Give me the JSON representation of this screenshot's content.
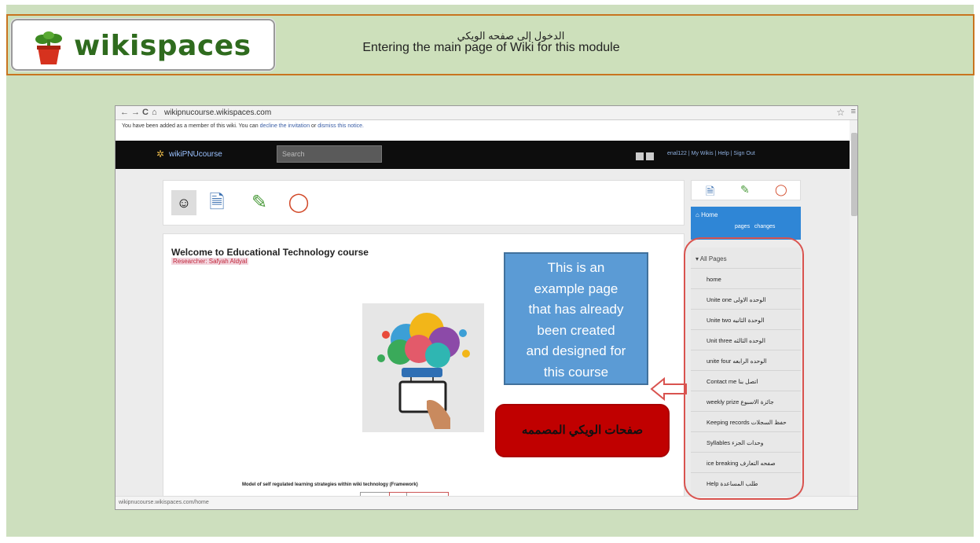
{
  "header": {
    "logo_text": "wikispaces",
    "title_arabic": "الدخول إلى صفحه الويكي",
    "title_english": "Entering the main page of Wiki for this module"
  },
  "browser": {
    "nav_back": "←",
    "nav_forward": "→",
    "nav_reload": "C",
    "nav_home": "⌂",
    "url": "wikipnucourse.wikispaces.com",
    "notice_prefix": "You have been added as a member of this wiki. You can",
    "notice_decline": "decline the invitation",
    "notice_or": "or",
    "notice_dismiss": "dismiss this notice.",
    "status_url": "wikipnucourse.wikispaces.com/home"
  },
  "wiki_bar": {
    "wiki_name": "wikiPNUcourse",
    "search_placeholder": "Search",
    "user_links": "enal122 | My Wikis | Help | Sign Out"
  },
  "page": {
    "welcome_title": "Welcome to Educational Technology course",
    "researcher": "Researcher: Safyah Aldyal",
    "model_caption": "Model of self regulated learning strategies within wiki technology (Framework)"
  },
  "sidebar": {
    "home_label": "Home",
    "pages_link": "pages",
    "changes_link": "changes",
    "list_header": "All Pages",
    "items": [
      {
        "label": "home"
      },
      {
        "label": "Unite one الوحده الاولى"
      },
      {
        "label": "Unite two الوحدة الثانيه"
      },
      {
        "label": "Unit three الوحده الثالثه"
      },
      {
        "label": "unite four الوحده الرابعه"
      },
      {
        "label": "Contact me اتصل بنا"
      },
      {
        "label": "weekly prize جائزة الاسبوع"
      },
      {
        "label": "Keeping records حفظ السجلات"
      },
      {
        "label": "Syllables وحدات الجزء"
      },
      {
        "label": "ice breaking صفحه التعارف"
      },
      {
        "label": "Help طلب المساعدة"
      }
    ]
  },
  "callouts": {
    "blue_text_lines": [
      "This is an",
      "example page",
      "that has already",
      "been created",
      "and designed for",
      "this course"
    ],
    "red_text": "صفحات الويكي المصممه"
  },
  "colors": {
    "background": "#cddfbe",
    "header_border": "#c8741f",
    "callout_blue": "#5b9bd5",
    "callout_red": "#c00000",
    "highlight_oval": "#d9534f",
    "wiki_bar": "#0d0d0d",
    "home_box": "#2f86d6"
  }
}
